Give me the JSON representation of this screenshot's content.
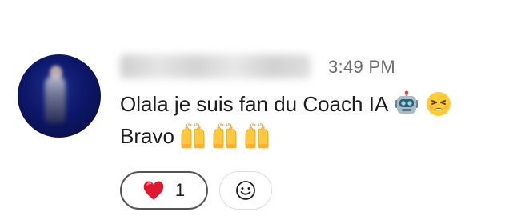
{
  "message": {
    "timestamp": "3:49 PM",
    "text_line1": "Olala je suis fan du Coach IA",
    "text_line2": "Bravo",
    "line1_emojis": [
      "robot-face",
      "tired-face"
    ],
    "line2_emojis": [
      "raising-hands",
      "raising-hands",
      "raising-hands"
    ]
  },
  "reactions": [
    {
      "emoji": "red-heart",
      "count": "1",
      "selected": true
    }
  ],
  "colors": {
    "text": "#1d1c1d",
    "timestamp": "#6b6d70",
    "reaction_border_selected": "#545454",
    "heart": "#e0182d"
  }
}
